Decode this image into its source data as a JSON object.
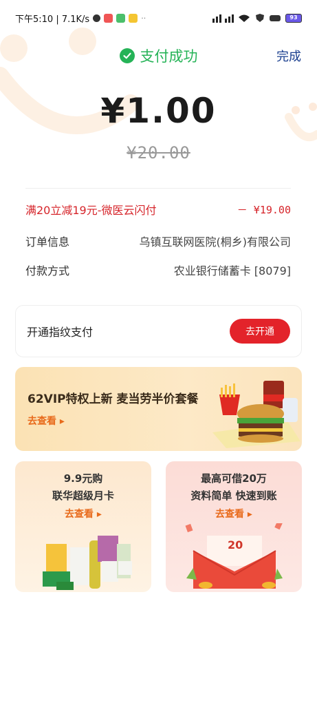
{
  "status_bar": {
    "time_speed": "下午5:10 | 7.1K/s",
    "battery": "93"
  },
  "header": {
    "success_text": "支付成功",
    "done_label": "完成"
  },
  "payment": {
    "amount": "¥1.00",
    "original_amount": "¥20.00"
  },
  "details": {
    "discount_label": "满20立减19元-微医云闪付",
    "discount_value": "－ ¥19.00",
    "order_label": "订单信息",
    "order_value": "乌镇互联网医院(桐乡)有限公司",
    "method_label": "付款方式",
    "method_value": "农业银行储蓄卡 [8079]"
  },
  "fingerprint": {
    "label": "开通指纹支付",
    "button": "去开通"
  },
  "banner": {
    "title": "62VIP特权上新 麦当劳半价套餐",
    "link": "去查看 ▸"
  },
  "promos": [
    {
      "line1": "9.9元购",
      "line2": "联华超级月卡",
      "link": "去查看 ▸"
    },
    {
      "line1": "最高可借20万",
      "line2": "资料简单  快速到账",
      "link": "去查看 ▸",
      "envelope_amount": "20"
    }
  ],
  "colors": {
    "success_green": "#25b357",
    "accent_red": "#e3232a",
    "done_blue": "#1a3f8f",
    "link_orange": "#e86a1b"
  }
}
